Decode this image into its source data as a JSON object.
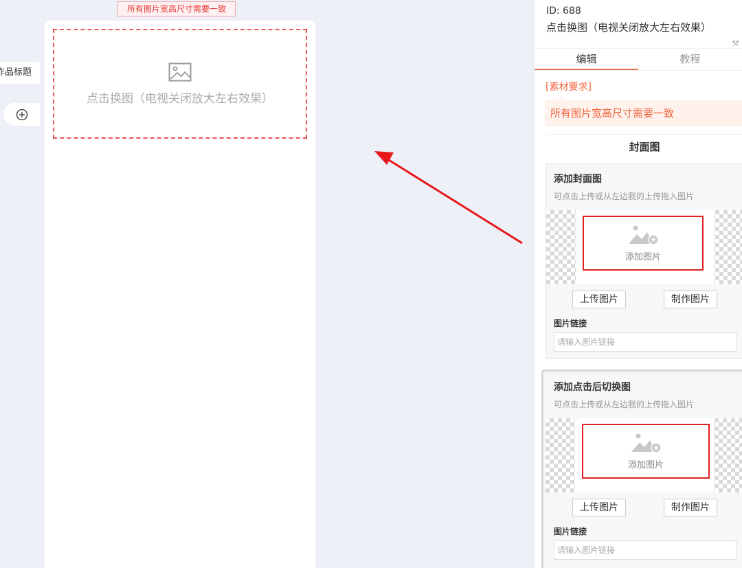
{
  "left": {
    "tab_label": "作品标题",
    "add_icon": "plus-circle-icon",
    "requirement_tag": "所有图片宽高尺寸需要一致",
    "slot_icon": "image-icon",
    "slot_label": "点击换图（电视关闭放大左右效果）"
  },
  "panel": {
    "id_line": "ID: 688",
    "component_name": "点击换图（电视关闭放大左右效果）",
    "tools_icon": "wrench-icon",
    "tabs": [
      {
        "label": "编辑",
        "active": true
      },
      {
        "label": "教程",
        "active": false
      }
    ],
    "requirement_title": "[素材要求]",
    "requirement_text": "所有图片宽高尺寸需要一致",
    "section_title": "封面图",
    "cards": [
      {
        "title": "添加封面图",
        "hint": "可点击上传或从左边我的上传拖入图片",
        "upload_icon": "add-image-icon",
        "upload_label": "添加图片",
        "upload_button": "上传图片",
        "make_button": "制作图片",
        "link_label": "图片链接",
        "link_placeholder": "请输入图片链接",
        "link_value": ""
      },
      {
        "title": "添加点击后切换图",
        "hint": "可点击上传或从左边我的上传拖入图片",
        "upload_icon": "add-image-icon",
        "upload_label": "添加图片",
        "upload_button": "上传图片",
        "make_button": "制作图片",
        "link_label": "图片链接",
        "link_placeholder": "请输入图片链接",
        "link_value": ""
      }
    ]
  },
  "colors": {
    "canvas_background": "#eef0f7",
    "accent_red": "#e02020",
    "requirement_orange": "#f0653c",
    "annotation_arrow": "#e8161b"
  }
}
